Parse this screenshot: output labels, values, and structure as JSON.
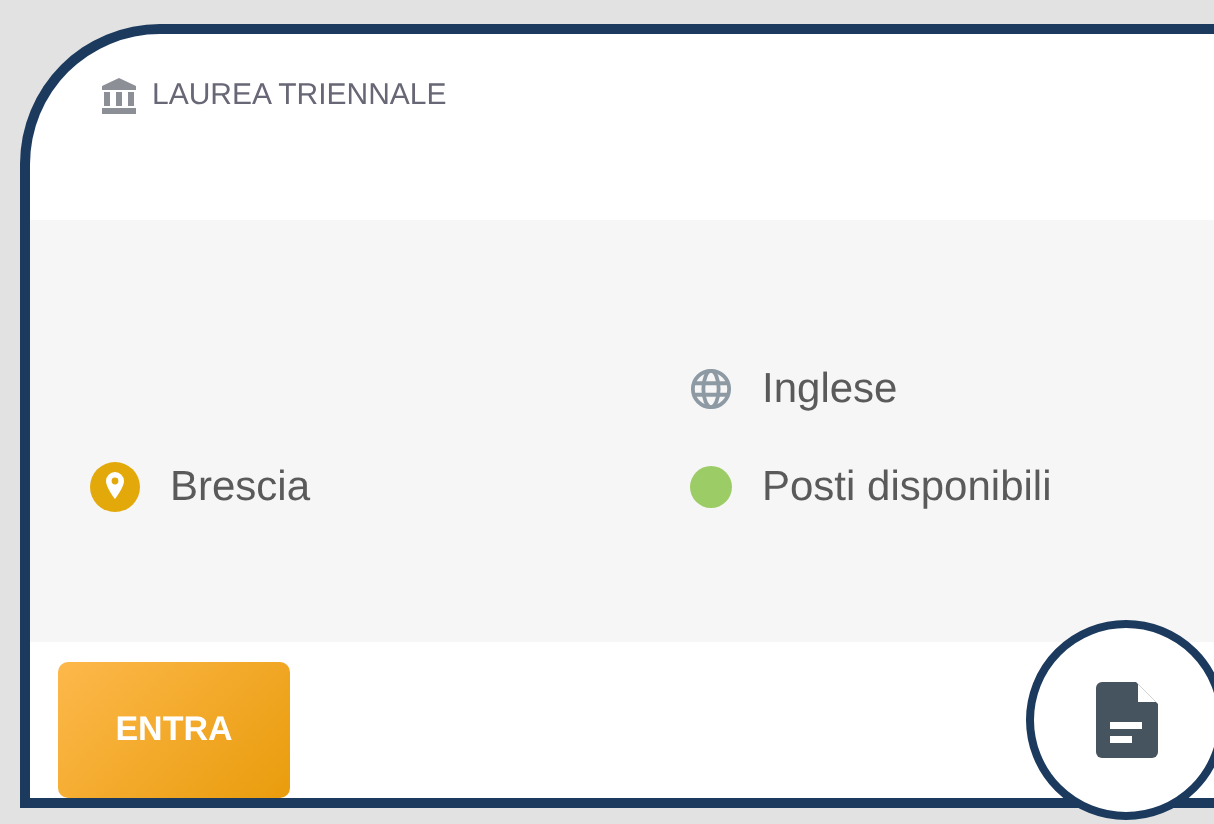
{
  "card": {
    "degree_type": "LAUREA TRIENNALE",
    "location": "Brescia",
    "language": "Inglese",
    "availability": {
      "label": "Posti disponibili",
      "color": "#9ccc65"
    },
    "enter_button": "ENTRA"
  }
}
